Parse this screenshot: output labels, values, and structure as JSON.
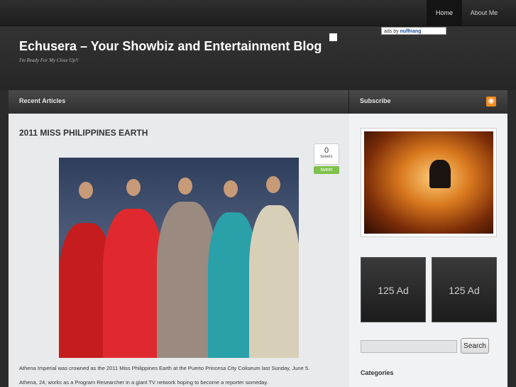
{
  "nav": {
    "items": [
      {
        "label": "Home",
        "active": true
      },
      {
        "label": "About Me",
        "active": false
      }
    ]
  },
  "header": {
    "title": "Echusera – Your Showbiz and Entertainment Blog",
    "tagline": "I'm Ready For My Close Up!!",
    "ad_badge": {
      "prefix": "ads by",
      "brand": "nuffnang"
    }
  },
  "bars": {
    "recent": "Recent Articles",
    "subscribe": "Subscribe",
    "rss_icon": "rss-icon"
  },
  "post": {
    "title": "2011 MISS PHILIPPINES EARTH",
    "tweets": {
      "count": "0",
      "unit": "tweets",
      "button": "tweet"
    },
    "paragraphs": [
      "Athena Imperial was crowned as the 2011 Miss Philippines Earth at the Puerto Princesa City Coliseum last Sunday, June 5.",
      "Athena, 24, works as a Program Researcher in a giant TV network hoping to become a reporter someday."
    ]
  },
  "sidebar": {
    "ads": [
      "125 Ad",
      "125 Ad"
    ],
    "search": {
      "value": "",
      "button": "Search"
    },
    "categories_title": "Categories"
  },
  "colors": {
    "accent_rss": "#f28c23",
    "tweet_green": "#7dc24b"
  }
}
